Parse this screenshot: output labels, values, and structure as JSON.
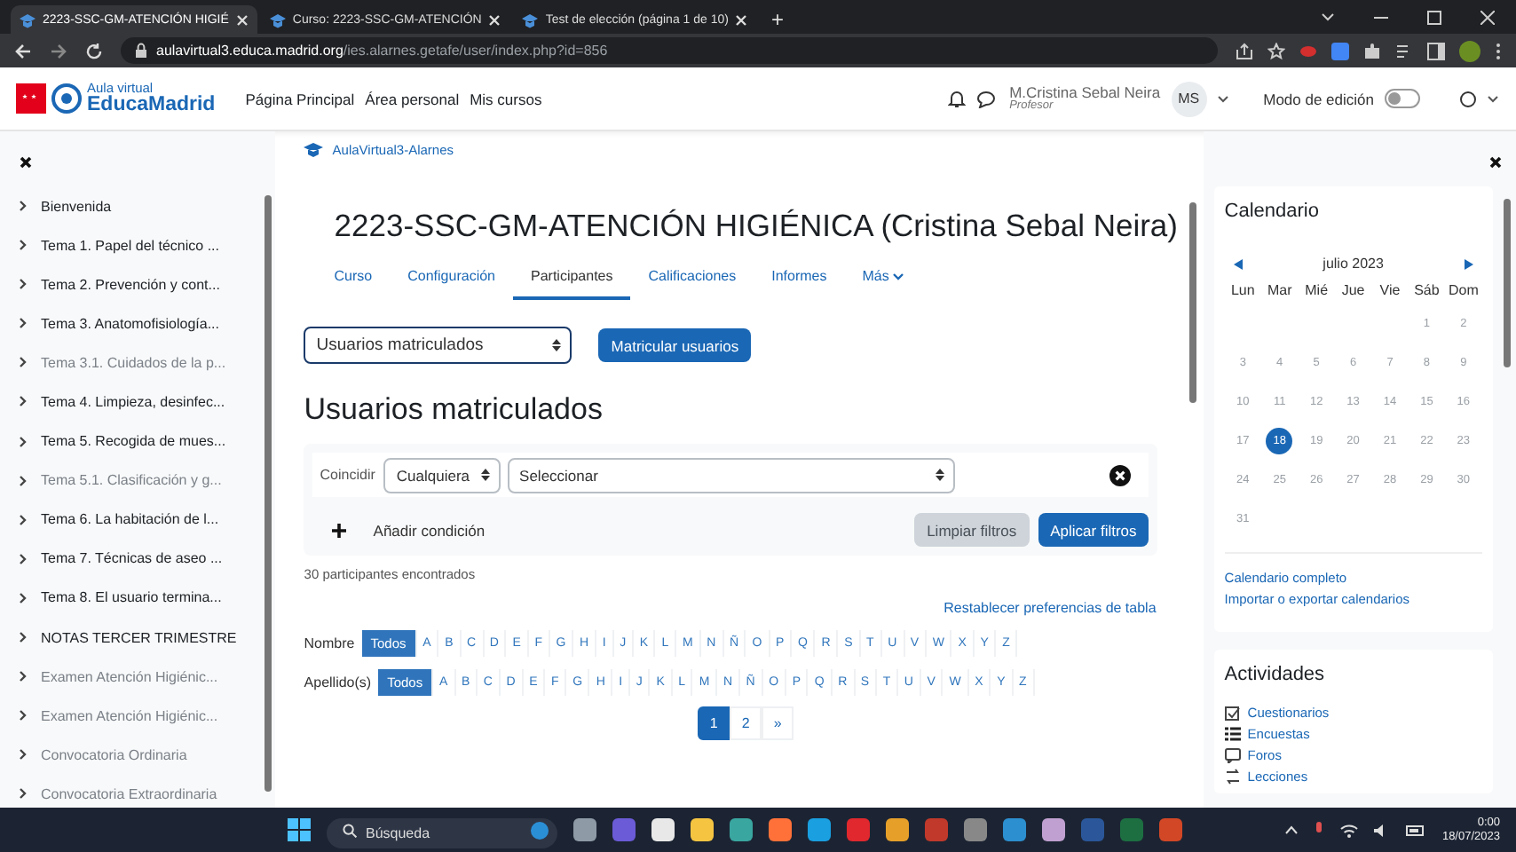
{
  "browser": {
    "tabs": [
      {
        "title": "2223-SSC-GM-ATENCIÓN HIGIÉ",
        "selected": true
      },
      {
        "title": "Curso: 2223-SSC-GM-ATENCIÓN",
        "selected": false
      },
      {
        "title": "Test de elección (página 1 de 10)",
        "selected": false
      }
    ],
    "new_tab": "+",
    "url_host": "aulavirtual3.educa.madrid.org",
    "url_path": "/ies.alarnes.getafe/user/index.php?id=856"
  },
  "navbar": {
    "brand_top": "Aula virtual",
    "brand_name": "EducaMadrid",
    "links": [
      "Página Principal",
      "Área personal",
      "Mis cursos"
    ],
    "user_name": "M.Cristina Sebal Neira",
    "user_role": "Profesor",
    "initials": "MS",
    "edit_mode_label": "Modo de edición",
    "edit_mode_on": false
  },
  "sidebar": {
    "items": [
      {
        "label": "Bienvenida",
        "dimmed": false
      },
      {
        "label": "Tema 1. Papel del técnico ...",
        "dimmed": false
      },
      {
        "label": "Tema 2. Prevención y cont...",
        "dimmed": false
      },
      {
        "label": "Tema 3. Anatomofisiología...",
        "dimmed": false
      },
      {
        "label": "Tema 3.1. Cuidados de la p...",
        "dimmed": true
      },
      {
        "label": "Tema 4. Limpieza, desinfec...",
        "dimmed": false
      },
      {
        "label": "Tema 5. Recogida de mues...",
        "dimmed": false
      },
      {
        "label": "Tema 5.1. Clasificación y g...",
        "dimmed": true
      },
      {
        "label": "Tema 6. La habitación de l...",
        "dimmed": false
      },
      {
        "label": "Tema 7. Técnicas de aseo ...",
        "dimmed": false
      },
      {
        "label": "Tema 8. El usuario termina...",
        "dimmed": false
      },
      {
        "label": "NOTAS TERCER TRIMESTRE",
        "dimmed": false
      },
      {
        "label": "Examen Atención Higiénic...",
        "dimmed": true
      },
      {
        "label": "Examen Atención Higiénic...",
        "dimmed": true
      },
      {
        "label": "Convocatoria Ordinaria",
        "dimmed": true
      },
      {
        "label": "Convocatoria Extraordinaria",
        "dimmed": true
      }
    ]
  },
  "main": {
    "breadcrumb": "AulaVirtual3-Alarnes",
    "title": "2223-SSC-GM-ATENCIÓN HIGIÉNICA (Cristina Sebal Neira)",
    "course_tabs": [
      {
        "label": "Curso",
        "selected": false
      },
      {
        "label": "Configuración",
        "selected": false
      },
      {
        "label": "Participantes",
        "selected": true
      },
      {
        "label": "Calificaciones",
        "selected": false
      },
      {
        "label": "Informes",
        "selected": false
      },
      {
        "label": "Más",
        "selected": false,
        "dropdown": true
      }
    ],
    "enrol_select": "Usuarios matriculados",
    "enrol_button": "Matricular usuarios",
    "heading": "Usuarios matriculados",
    "filter": {
      "match_label": "Coincidir",
      "match_value": "Cualquiera",
      "condition_value": "Seleccionar",
      "add_condition": "Añadir condición",
      "clear_button": "Limpiar filtros",
      "apply_button": "Aplicar filtros"
    },
    "count": "30 participantes encontrados",
    "reset_link": "Restablecer preferencias de tabla",
    "initials_bars": [
      {
        "label": "Nombre",
        "options": [
          {
            "label": "Todos",
            "selected": true
          },
          {
            "label": "A",
            "selected": false
          },
          {
            "label": "B",
            "selected": false
          },
          {
            "label": "C",
            "selected": false
          },
          {
            "label": "D",
            "selected": false
          },
          {
            "label": "E",
            "selected": false
          },
          {
            "label": "F",
            "selected": false
          },
          {
            "label": "G",
            "selected": false
          },
          {
            "label": "H",
            "selected": false
          },
          {
            "label": "I",
            "selected": false
          },
          {
            "label": "J",
            "selected": false
          },
          {
            "label": "K",
            "selected": false
          },
          {
            "label": "L",
            "selected": false
          },
          {
            "label": "M",
            "selected": false
          },
          {
            "label": "N",
            "selected": false
          },
          {
            "label": "Ñ",
            "selected": false
          },
          {
            "label": "O",
            "selected": false
          },
          {
            "label": "P",
            "selected": false
          },
          {
            "label": "Q",
            "selected": false
          },
          {
            "label": "R",
            "selected": false
          },
          {
            "label": "S",
            "selected": false
          },
          {
            "label": "T",
            "selected": false
          },
          {
            "label": "U",
            "selected": false
          },
          {
            "label": "V",
            "selected": false
          },
          {
            "label": "W",
            "selected": false
          },
          {
            "label": "X",
            "selected": false
          },
          {
            "label": "Y",
            "selected": false
          },
          {
            "label": "Z",
            "selected": false
          }
        ]
      },
      {
        "label": "Apellido(s)",
        "options": [
          {
            "label": "Todos",
            "selected": true
          },
          {
            "label": "A",
            "selected": false
          },
          {
            "label": "B",
            "selected": false
          },
          {
            "label": "C",
            "selected": false
          },
          {
            "label": "D",
            "selected": false
          },
          {
            "label": "E",
            "selected": false
          },
          {
            "label": "F",
            "selected": false
          },
          {
            "label": "G",
            "selected": false
          },
          {
            "label": "H",
            "selected": false
          },
          {
            "label": "I",
            "selected": false
          },
          {
            "label": "J",
            "selected": false
          },
          {
            "label": "K",
            "selected": false
          },
          {
            "label": "L",
            "selected": false
          },
          {
            "label": "M",
            "selected": false
          },
          {
            "label": "N",
            "selected": false
          },
          {
            "label": "Ñ",
            "selected": false
          },
          {
            "label": "O",
            "selected": false
          },
          {
            "label": "P",
            "selected": false
          },
          {
            "label": "Q",
            "selected": false
          },
          {
            "label": "R",
            "selected": false
          },
          {
            "label": "S",
            "selected": false
          },
          {
            "label": "T",
            "selected": false
          },
          {
            "label": "U",
            "selected": false
          },
          {
            "label": "V",
            "selected": false
          },
          {
            "label": "W",
            "selected": false
          },
          {
            "label": "X",
            "selected": false
          },
          {
            "label": "Y",
            "selected": false
          },
          {
            "label": "Z",
            "selected": false
          }
        ]
      }
    ],
    "pagination": [
      {
        "label": "1",
        "selected": true
      },
      {
        "label": "2",
        "selected": false
      },
      {
        "label": "»",
        "selected": false
      }
    ]
  },
  "calendar": {
    "title": "Calendario",
    "month": "julio 2023",
    "weekdays": [
      "Lun",
      "Mar",
      "Mié",
      "Jue",
      "Vie",
      "Sáb",
      "Dom"
    ],
    "weeks": [
      [
        {
          "day": "1",
          "selected": false
        },
        {
          "day": "2",
          "selected": false
        }
      ],
      [
        {
          "day": "3",
          "selected": false
        },
        {
          "day": "4",
          "selected": false
        },
        {
          "day": "5",
          "selected": false
        },
        {
          "day": "6",
          "selected": false
        },
        {
          "day": "7",
          "selected": false
        },
        {
          "day": "8",
          "selected": false
        },
        {
          "day": "9",
          "selected": false
        }
      ],
      [
        {
          "day": "10",
          "selected": false
        },
        {
          "day": "11",
          "selected": false
        },
        {
          "day": "12",
          "selected": false
        },
        {
          "day": "13",
          "selected": false
        },
        {
          "day": "14",
          "selected": false
        },
        {
          "day": "15",
          "selected": false
        },
        {
          "day": "16",
          "selected": false
        }
      ],
      [
        {
          "day": "17",
          "selected": false
        },
        {
          "day": "18",
          "selected": true
        },
        {
          "day": "19",
          "selected": false
        },
        {
          "day": "20",
          "selected": false
        },
        {
          "day": "21",
          "selected": false
        },
        {
          "day": "22",
          "selected": false
        },
        {
          "day": "23",
          "selected": false
        }
      ],
      [
        {
          "day": "24",
          "selected": false
        },
        {
          "day": "25",
          "selected": false
        },
        {
          "day": "26",
          "selected": false
        },
        {
          "day": "27",
          "selected": false
        },
        {
          "day": "28",
          "selected": false
        },
        {
          "day": "29",
          "selected": false
        },
        {
          "day": "30",
          "selected": false
        }
      ],
      [
        {
          "day": "31",
          "selected": false
        }
      ]
    ],
    "links": [
      "Calendario completo",
      "Importar o exportar calendarios"
    ]
  },
  "activities": {
    "title": "Actividades",
    "items": [
      {
        "label": "Cuestionarios",
        "kind": "quiz"
      },
      {
        "label": "Encuestas",
        "kind": "survey"
      },
      {
        "label": "Foros",
        "kind": "forum"
      },
      {
        "label": "Lecciones",
        "kind": "lesson"
      }
    ]
  },
  "taskbar": {
    "search_placeholder": "Búsqueda",
    "time": "0:00",
    "date": "18/07/2023"
  }
}
